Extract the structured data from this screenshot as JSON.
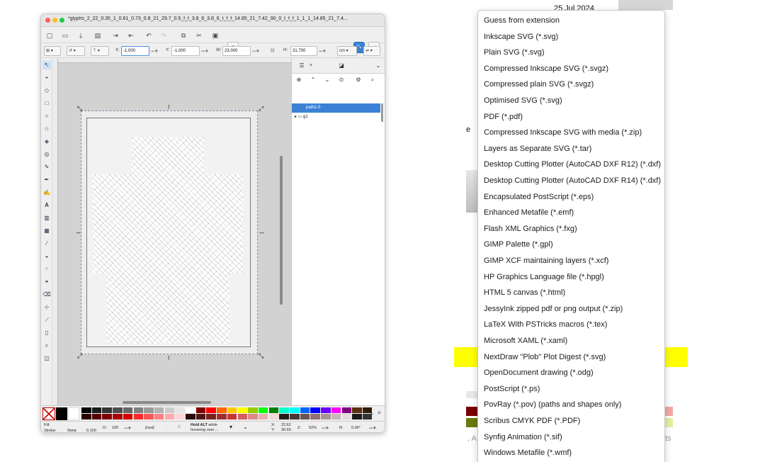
{
  "inkscape": {
    "title": "*glyphs_2_22_0.35_1_0.61_0.73_0.8_21_29.7_0.5_f_f_3.8_6_3.8_6_t_f_f_14.85_21_7.42_90_0_t_f_f_1_1_1_14.85_21_7.4...",
    "controls": {
      "x_label": "X:",
      "x_value": "-1.000",
      "y_label": "Y:",
      "y_value": "-1.000",
      "w_label": "W:",
      "w_value": "23.000",
      "h_label": "H:",
      "h_value": "31.700",
      "unit": "cm"
    },
    "layers": [
      {
        "name": "path1-0",
        "selected": true
      },
      {
        "name": "g1",
        "selected": false
      }
    ],
    "status": {
      "fill_label": "Fill:",
      "stroke_label": "Stroke:",
      "stroke_value": "None",
      "stroke_width": "0.100",
      "opacity_label": "O:",
      "opacity_value": "100",
      "layer": "[root]",
      "message_bold": "Hold ALT",
      "message_rest": " while",
      "message_line2": "hovering over ...",
      "x_label": "X:",
      "x_value": "22.62",
      "y_label": "Y:",
      "y_value": "30.69",
      "zoom_label": "Z:",
      "zoom_value": "52%",
      "rot_label": "R:",
      "rot_value": "0.00°"
    },
    "palette_top": [
      "#000000",
      "#1a1a1a",
      "#333333",
      "#4d4d4d",
      "#666666",
      "#808080",
      "#999999",
      "#b3b3b3",
      "#cccccc",
      "#e6e6e6",
      "#ffffff",
      "#800000",
      "#ff0000",
      "#ff6600",
      "#ffcc00",
      "#ffff00",
      "#99cc00",
      "#00ff00",
      "#008000",
      "#00ffcc",
      "#00ffff",
      "#0066ff",
      "#0000ff",
      "#6600ff",
      "#ff00ff",
      "#800080",
      "#5a2d0c",
      "#2d1a00"
    ],
    "palette_bottom": [
      "#2b0000",
      "#550000",
      "#800000",
      "#aa0000",
      "#d40000",
      "#ff2a2a",
      "#ff5555",
      "#ff8080",
      "#ffaaaa",
      "#ffd5d5",
      "#280b0b",
      "#501616",
      "#782121",
      "#a02c2c",
      "#c83737",
      "#d35f5f",
      "#de8787",
      "#e9afaf",
      "#f4d7d7",
      "#241c1c",
      "#483737",
      "#6c5353",
      "#916f6f",
      "#ac9393",
      "#c8b7b7",
      "#e3dbdb",
      "#1a1a1a",
      "#333333"
    ]
  },
  "background": {
    "date": "25 Jul 2024",
    "partial_e": "e",
    "partial_a": ", A",
    "partial_ts": "ts"
  },
  "menu": {
    "items": [
      "Guess from extension",
      "Inkscape SVG (*.svg)",
      "Plain SVG (*.svg)",
      "Compressed Inkscape SVG (*.svgz)",
      "Compressed plain SVG (*.svgz)",
      "Optimised SVG (*.svg)",
      "PDF (*.pdf)",
      "Compressed Inkscape SVG with media (*.zip)",
      "Layers as Separate SVG (*.tar)",
      "Desktop Cutting Plotter (AutoCAD DXF R12) (*.dxf)",
      "Desktop Cutting Plotter (AutoCAD DXF R14) (*.dxf)",
      "Encapsulated PostScript (*.eps)",
      "Enhanced Metafile (*.emf)",
      "Flash XML Graphics (*.fxg)",
      "GIMP Palette (*.gpl)",
      "GIMP XCF maintaining layers (*.xcf)",
      "HP Graphics Language file (*.hpgl)",
      "HTML 5 canvas (*.html)",
      "JessyInk zipped pdf or png output (*.zip)",
      "LaTeX With PSTricks macros (*.tex)",
      "Microsoft XAML (*.xaml)",
      "NextDraw \"Plob\" Plot Digest (*.svg)",
      "OpenDocument drawing (*.odg)",
      "PostScript (*.ps)",
      "PovRay (*.pov) (paths and shapes only)",
      "Scribus CMYK PDF (*.PDF)",
      "Synfig Animation (*.sif)",
      "Windows Metafile (*.wmf)"
    ],
    "highlighted_index": 21,
    "highlight_color": "#ffff00"
  }
}
